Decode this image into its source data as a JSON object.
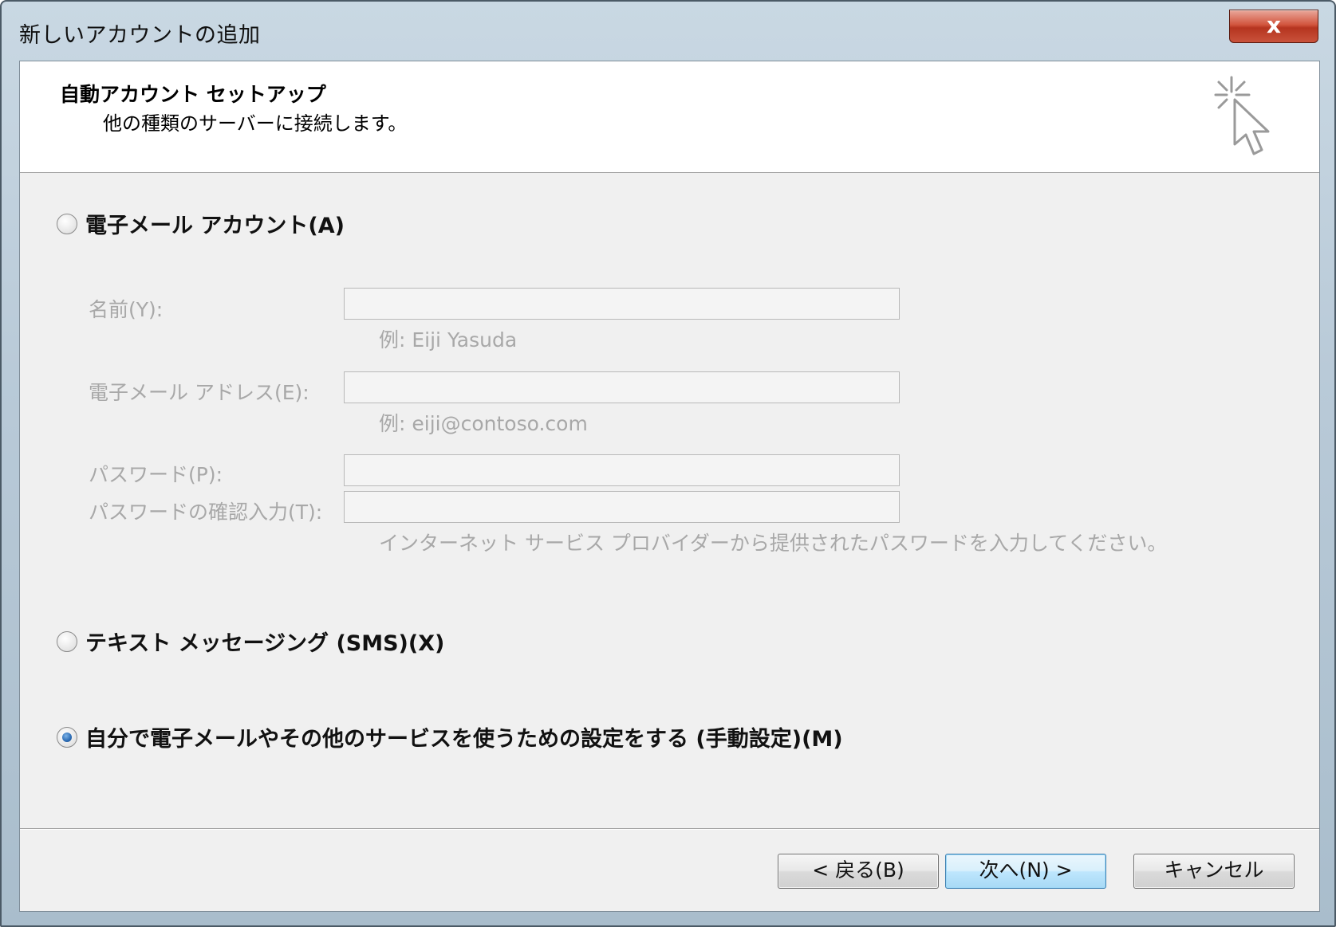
{
  "window": {
    "title": "新しいアカウントの追加",
    "close_label": "x"
  },
  "header": {
    "title": "自動アカウント セットアップ",
    "subtitle": "他の種類のサーバーに接続します。"
  },
  "options": {
    "email_account": {
      "label": "電子メール アカウント(A)",
      "checked": false
    },
    "sms": {
      "label": "テキスト メッセージング (SMS)(X)",
      "checked": false
    },
    "manual": {
      "label": "自分で電子メールやその他のサービスを使うための設定をする (手動設定)(M)",
      "checked": true
    }
  },
  "form": {
    "name_label": "名前(Y):",
    "name_value": "",
    "name_hint": "例: Eiji Yasuda",
    "email_label": "電子メール アドレス(E):",
    "email_value": "",
    "email_hint": "例: eiji@contoso.com",
    "password_label": "パスワード(P):",
    "password_value": "",
    "confirm_label": "パスワードの確認入力(T):",
    "confirm_value": "",
    "password_hint": "インターネット サービス プロバイダーから提供されたパスワードを入力してください。"
  },
  "buttons": {
    "back": "< 戻る(B)",
    "next": "次へ(N) >",
    "cancel": "キャンセル"
  },
  "colors": {
    "accent": "#2b6bb3",
    "disabled_text": "#a8a8a8",
    "dialog_bg": "#f0f0f0"
  }
}
